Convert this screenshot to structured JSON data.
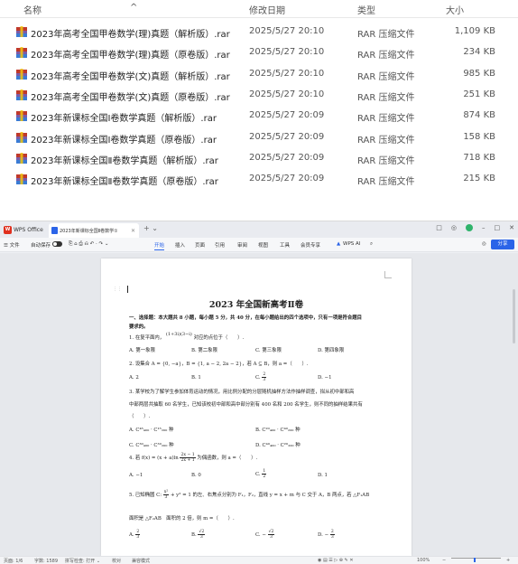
{
  "explorer": {
    "columns": {
      "name": "名称",
      "modified": "修改日期",
      "type": "类型",
      "size": "大小"
    },
    "sort_glyph": "^",
    "files": [
      {
        "name": "2023年高考全国甲卷数学(理)真题（解析版）.rar",
        "modified": "2025/5/27 20:10",
        "type": "RAR 压缩文件",
        "size": "1,109 KB"
      },
      {
        "name": "2023年高考全国甲卷数学(理)真题（原卷版）.rar",
        "modified": "2025/5/27 20:10",
        "type": "RAR 压缩文件",
        "size": "234 KB"
      },
      {
        "name": "2023年高考全国甲卷数学(文)真题（解析版）.rar",
        "modified": "2025/5/27 20:10",
        "type": "RAR 压缩文件",
        "size": "985 KB"
      },
      {
        "name": "2023年高考全国甲卷数学(文)真题（原卷版）.rar",
        "modified": "2025/5/27 20:10",
        "type": "RAR 压缩文件",
        "size": "251 KB"
      },
      {
        "name": "2023年新课标全国Ⅰ卷数学真题（解析版）.rar",
        "modified": "2025/5/27 20:09",
        "type": "RAR 压缩文件",
        "size": "874 KB"
      },
      {
        "name": "2023年新课标全国Ⅰ卷数学真题（原卷版）.rar",
        "modified": "2025/5/27 20:09",
        "type": "RAR 压缩文件",
        "size": "158 KB"
      },
      {
        "name": "2023年新课标全国Ⅱ卷数学真题（解析版）.rar",
        "modified": "2025/5/27 20:09",
        "type": "RAR 压缩文件",
        "size": "718 KB"
      },
      {
        "name": "2023年新课标全国Ⅱ卷数学真题（原卷版）.rar",
        "modified": "2025/5/27 20:09",
        "type": "RAR 压缩文件",
        "size": "215 KB"
      }
    ],
    "file_icon": "rar-archive-icon"
  },
  "wps": {
    "app_name": "WPS Office",
    "doc_tab": "2023年新课标全国Ⅱ卷数学①",
    "tab_close": "✕",
    "new_tab": "+ ⌄",
    "window_controls": [
      "□",
      "◎",
      "–",
      "□",
      "✕"
    ],
    "menu": {
      "file": "☰ 文件",
      "autosave": "自动保存",
      "quick_tools": "⎘ ⌂ ⎙ ⎌ ↶ · ↷ ⌄",
      "items": [
        "开始",
        "插入",
        "页面",
        "引用",
        "审阅",
        "视图",
        "工具",
        "会员专享"
      ],
      "active": "开始",
      "ai": "WPS AI",
      "search": "⌕",
      "share": "分享"
    },
    "document": {
      "title": "2023 年全国新高考Ⅱ卷",
      "section": "一、选择题：本大题共 8 小题，每小题 5 分，共 40 分，在每小题给出的四个选项中，只有一项是符合题目",
      "section2": "要求的。",
      "q1_a": "1. 在复平面内，",
      "q1_expr": "(1+3i)(3−i)",
      "q1_b": "对应的点位于（　　）.",
      "q1_opts": [
        "A. 第一象限",
        "B. 第二象限",
        "C. 第三象限",
        "D. 第四象限"
      ],
      "q2": "2. 设集合 A = {0, −a}，B = {1, a − 2, 2a − 2}，若 A ⊆ B，则 a =（　　）.",
      "q2_opts": [
        "A. 2",
        "B. 1",
        "C.",
        "D. −1"
      ],
      "q2_c_num": "2",
      "q2_c_den": "3",
      "q3_1": "3. 某学校为了解学生参加体育运动的情况，用比例分配的分层随机抽样方法作抽样调查，拟从初中部和高",
      "q3_2": "中部两层共抽取 60 名学生，已知该校初中部和高中部分别有 400 名和 200 名学生，则不同的抽样结果共有",
      "q3_3": "（　　）.",
      "q3_opts": [
        "A. C⁴⁵₄₀₀ · C¹⁵₂₀₀ 种",
        "B. C²⁰₄₀₀ · C⁴⁰₂₀₀ 种",
        "C. C³⁰₄₀₀ · C³⁰₂₀₀ 种",
        "D. C⁴⁰₄₀₀ · C²⁰₂₀₀ 种"
      ],
      "q4_a": "4. 若 f(x) = (x + a)ln",
      "q4_num": "2x − 1",
      "q4_den": "2x + 1",
      "q4_b": "为偶函数，则 a =（　　）.",
      "q4_opts": [
        "A. −1",
        "B. 0",
        "C.",
        "D. 1"
      ],
      "q4_c_num": "1",
      "q4_c_den": "2",
      "q5_a": "5. 已知椭圆 C:",
      "q5_num": "x²",
      "q5_den": "3",
      "q5_b": "+ y² = 1 的左、右焦点分别为 F₁，F₂，直线 y = x + m 与 C 交于 A，B 两点，若 △F₁AB",
      "q5_2": "面积是 △F₂AB　面积的 2 倍，则 m =（　　）.",
      "q5_opts": [
        "A.",
        "B.",
        "C.",
        "D."
      ],
      "q5_a_num": "2",
      "q5_a_den": "3",
      "q5_b_num": "√2",
      "q5_b_den": "3",
      "q5_c_num": "√2",
      "q5_c_den": "3",
      "q5_d_num": "2",
      "q5_d_den": "3"
    },
    "status": {
      "page": "页面: 1/6",
      "words": "字数: 1589",
      "spell": "拼写检查: 打开 ⌄",
      "proof": "校对",
      "compat": "兼容模式",
      "zoom": "100%"
    }
  }
}
